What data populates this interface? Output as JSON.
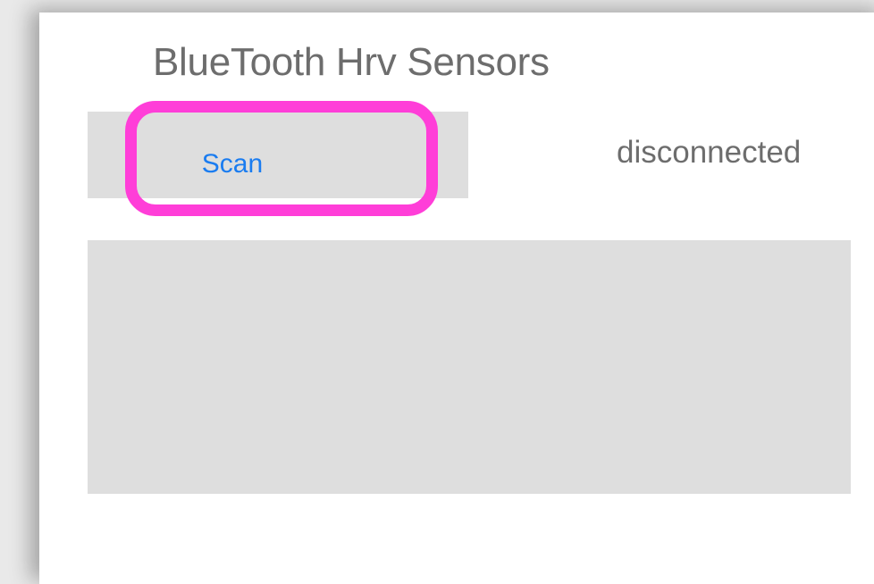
{
  "header": {
    "title": "BlueTooth Hrv Sensors"
  },
  "toolbar": {
    "scan_label": "Scan",
    "status_text": "disconnected"
  },
  "device_list": {
    "items": []
  },
  "colors": {
    "accent": "#1a7cf0",
    "highlight": "#ff3ed8",
    "panel_gray": "#dedede",
    "text_gray": "#6d6d6d"
  }
}
